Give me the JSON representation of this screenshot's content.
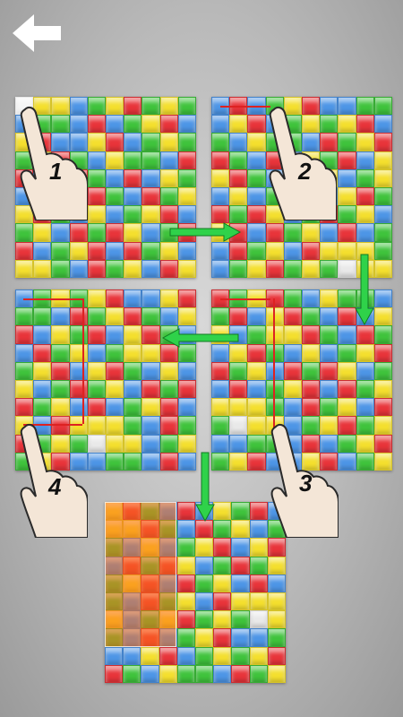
{
  "steps": [
    "1",
    "2",
    "3",
    "4"
  ],
  "colors": {
    "red": "#e8343a",
    "yellow": "#f4df2e",
    "green": "#3fc33c",
    "blue": "#4d95e6",
    "arrow": "#2fd24a",
    "background": "#bdbdbd"
  },
  "icons": {
    "back": "back-arrow-icon",
    "hand": "pointing-hand-icon",
    "flow": "green-arrow-icon"
  },
  "board_pattern": [
    "wyybgyrgyg",
    "bggbrbgyrb",
    "yrbbyrbgyg",
    "gyrgbyggbr",
    "rbyrgbrbyg",
    "bgyyrgbrgy",
    "yrgbybgyrb",
    "gybrgrybgr",
    "rbgyrbrgyb",
    "yygbrgybry"
  ],
  "selection": {
    "column_span": 4,
    "row_span": 8
  }
}
